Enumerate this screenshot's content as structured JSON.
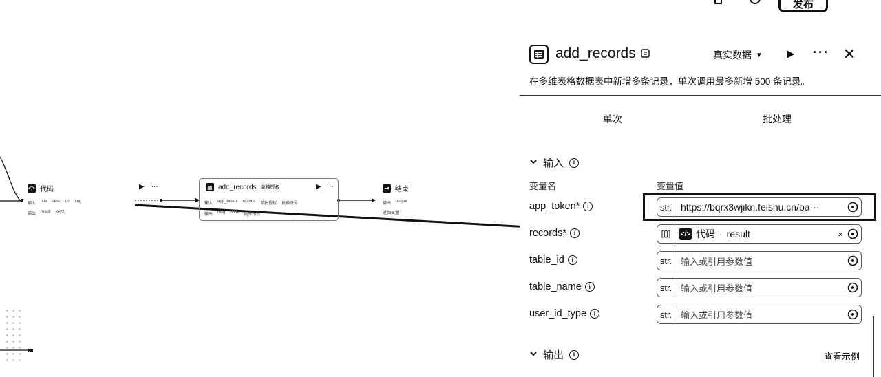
{
  "toolbar": {
    "publish_label": "发布"
  },
  "canvas": {
    "node_code": {
      "title": "代码",
      "inputs_label": "输入",
      "inputs": [
        "title",
        "desc",
        "url",
        "img"
      ],
      "outputs_label": "输出",
      "outputs": [
        "result",
        "key2"
      ]
    },
    "node_add": {
      "title": "add_records",
      "mode": "单独授权",
      "inputs_label": "输入",
      "inputs": [
        "app_token",
        "records"
      ],
      "auth": [
        "单独授权",
        "更换账号"
      ],
      "outputs_label": "输出",
      "outputs": [
        "msg",
        "code"
      ],
      "extra": "更多授权"
    },
    "node_end": {
      "title": "结束",
      "outputs_label": "输出",
      "outputs": [
        "output"
      ],
      "mode": "返回变量"
    }
  },
  "panel": {
    "title": "add_records",
    "mode_label": "真实数据",
    "description": "在多维表格数据表中新增多条记录，单次调用最多新增 500 条记录。",
    "tabs": [
      "单次",
      "批处理"
    ],
    "input_section": "输入",
    "col_name": "变量名",
    "col_value": "变量值",
    "params": [
      {
        "name": "app_token*",
        "type": "str.",
        "value": "https://bqrx3wjikn.feishu.cn/ba···"
      },
      {
        "name": "records*",
        "type": "[{}]",
        "ref_source": "代码",
        "ref_field": "result"
      },
      {
        "name": "table_id",
        "type": "str.",
        "placeholder": "输入或引用参数值"
      },
      {
        "name": "table_name",
        "type": "str.",
        "placeholder": "输入或引用参数值"
      },
      {
        "name": "user_id_type",
        "type": "str.",
        "placeholder": "输入或引用参数值"
      }
    ],
    "output_section": "输出",
    "example_label": "查看示例"
  }
}
